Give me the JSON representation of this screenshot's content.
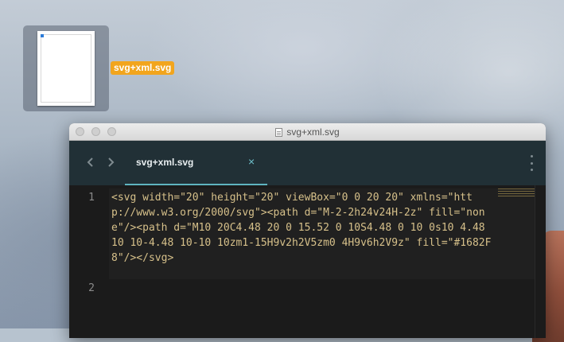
{
  "desktop": {
    "file": {
      "name": "svg+xml.svg",
      "icon": "svg-file-icon"
    }
  },
  "window": {
    "title": "svg+xml.svg",
    "title_icon": "document-icon"
  },
  "tabs": [
    {
      "label": "svg+xml.svg",
      "close": "×",
      "active": true
    }
  ],
  "nav": {
    "back": "chevron-left-icon",
    "forward": "chevron-right-icon",
    "menu": "vertical-ellipsis-icon"
  },
  "editor": {
    "lines": [
      {
        "number": "1",
        "text": "<svg width=\"20\" height=\"20\" viewBox=\"0 0 20 20\" xmlns=\"http://www.w3.org/2000/svg\"><path d=\"M-2-2h24v24H-2z\" fill=\"none\"/><path d=\"M10 20C4.48 20 0 15.52 0 10S4.48 0 10 0s10 4.48 10 10-4.48 10-10 10zm1-15H9v2h2V5zm0 4H9v6h2V9z\" fill=\"#1682F8\"/></svg>"
      },
      {
        "number": "2",
        "text": ""
      }
    ],
    "text_color": "#D6C08A"
  },
  "colors": {
    "file_label_bg": "#F2A51D",
    "tab_accent": "#5FB4C0",
    "editor_bg": "#1B1B1B"
  }
}
